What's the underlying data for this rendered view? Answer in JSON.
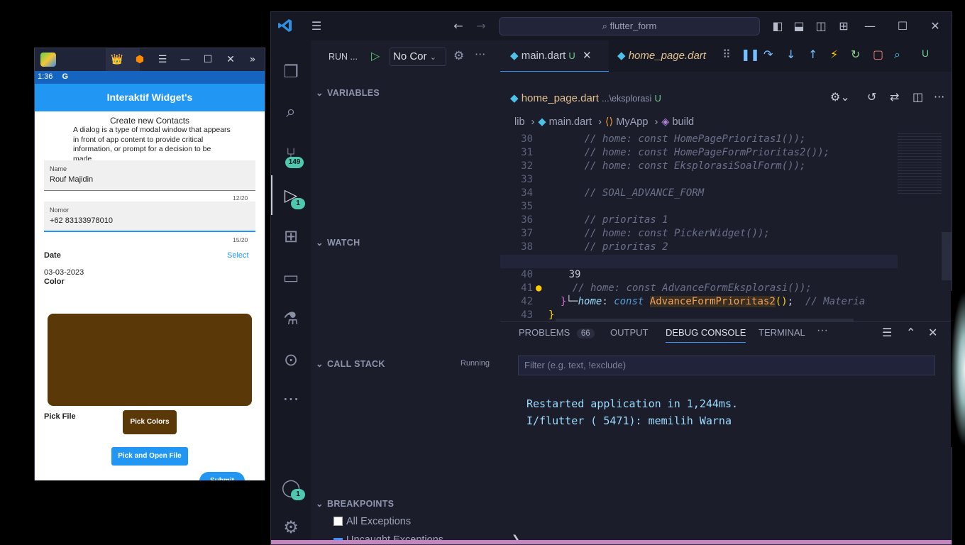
{
  "emulator": {
    "controls": [
      "👑",
      "⬢",
      "☰",
      "—",
      "☐",
      "✕",
      "»"
    ],
    "status_time": "1:36",
    "status_g": "G",
    "appbar_title": "Interaktif Widget's",
    "dialog_title": "Create new Contacts",
    "dialog_desc": "A dialog is a type of modal window that appears in front of app content to provide critical information, or prompt for a decision to be made.",
    "name_label": "Name",
    "name_value": "Rouf Majidin",
    "name_counter": "12/20",
    "nomor_label": "Nomor",
    "nomor_value": "+62 83133978010",
    "nomor_counter": "15/20",
    "date_label": "Date",
    "date_select": "Select",
    "date_value": "03-03-2023",
    "color_label": "Color",
    "color_value": "#5a3808",
    "pick_colors": "Pick Colors",
    "pick_file_label": "Pick File",
    "pick_open_file": "Pick and Open File",
    "submit": "Submit"
  },
  "vscode": {
    "search": "flutter_form",
    "run_label": "RUN ...",
    "run_config": "No Cor",
    "tabs": [
      {
        "label": "main.dart",
        "suffix": "U"
      },
      {
        "label": "home_page.dart"
      }
    ],
    "debug_toolbar_u": "U",
    "subtab": {
      "label": "home_page.dart",
      "path": "...\\eksplorasi",
      "suffix": "U"
    },
    "breadcrumb": [
      "lib",
      "main.dart",
      "MyApp",
      "build"
    ],
    "activity_badges": {
      "scm": "149",
      "debug": "1",
      "account": "1"
    },
    "sections": {
      "variables": "VARIABLES",
      "watch": "WATCH",
      "call_stack": "CALL STACK",
      "call_stack_status": "Running",
      "breakpoints": "BREAKPOINTS"
    },
    "breakpoints": [
      {
        "label": "All Exceptions",
        "checked": false
      },
      {
        "label": "Uncaught Exceptions",
        "checked": true
      }
    ],
    "code": [
      {
        "n": "30",
        "text": "      // home: const HomePagePrioritas1());"
      },
      {
        "n": "31",
        "text": "      // home: const HomePageFormPrioritas2());"
      },
      {
        "n": "32",
        "text": "      // home: const EksplorasiSoalForm());"
      },
      {
        "n": "33",
        "text": ""
      },
      {
        "n": "34",
        "text": "      // SOAL_ADVANCE_FORM"
      },
      {
        "n": "35",
        "text": ""
      },
      {
        "n": "36",
        "text": "      // prioritas 1"
      },
      {
        "n": "37",
        "text": "      // home: const PickerWidget());"
      },
      {
        "n": "38",
        "text": "      // prioritas 2"
      },
      {
        "n": "39",
        "text": "home: const AdvanceFormPrioritas2(); // Materia"
      },
      {
        "n": "40",
        "text": ""
      },
      {
        "n": "41",
        "text": "    // home: const AdvanceFormEksplorasi());"
      },
      {
        "n": "42",
        "text": "  }"
      },
      {
        "n": "43",
        "text": "}"
      }
    ],
    "line39": {
      "kw1": "home",
      "colon": ":",
      "kw2": "const",
      "fn": "AdvanceFormPrioritas2",
      "call": "()",
      "semi": ";",
      "comment": "// Materia"
    },
    "panel_tabs": {
      "problems": "PROBLEMS",
      "problems_count": "66",
      "output": "OUTPUT",
      "debug_console": "DEBUG CONSOLE",
      "terminal": "TERMINAL",
      "more": "···"
    },
    "filter_placeholder": "Filter (e.g. text, !exclude)",
    "console": [
      "Restarted application in 1,244ms.",
      "I/flutter ( 5471): memilih Warna"
    ],
    "prompt": "❯"
  }
}
